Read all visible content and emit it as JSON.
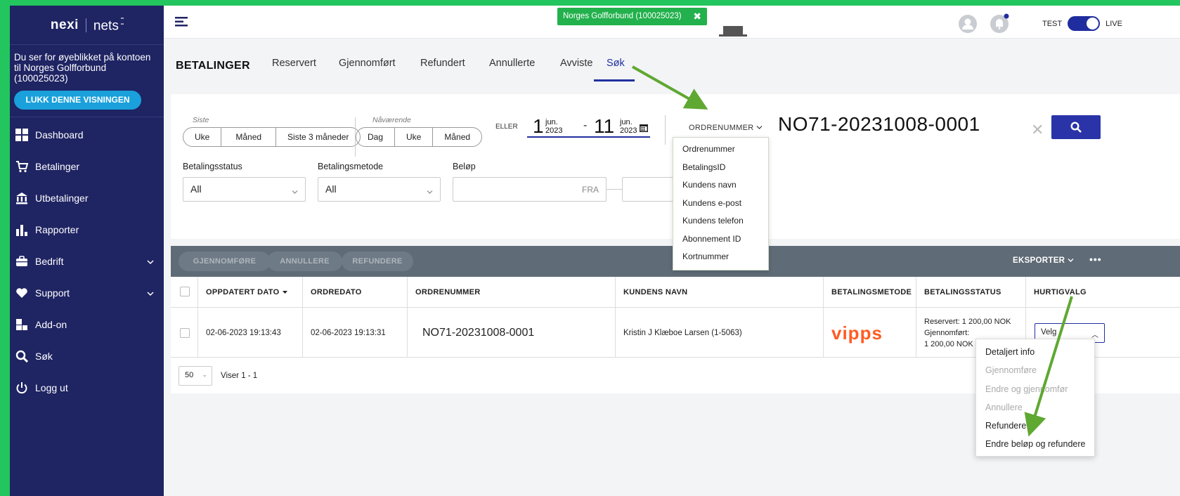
{
  "colors": {
    "sidebar": "#1f2463",
    "accent": "#2130a0",
    "badge": "#22b14c",
    "primary_button": "#2a34a8",
    "vipps": "#ff5b24"
  },
  "sidebar": {
    "logo_primary": "nexi",
    "logo_secondary": "nets",
    "impersonation_text": "Du ser for øyeblikket på kontoen til Norges Golfforbund (100025023)",
    "close_view_button": "LUKK DENNE VISNINGEN",
    "nav": [
      {
        "label": "Dashboard",
        "icon": "dashboard-icon"
      },
      {
        "label": "Betalinger",
        "icon": "cart-icon"
      },
      {
        "label": "Utbetalinger",
        "icon": "bank-icon"
      },
      {
        "label": "Rapporter",
        "icon": "bar-chart-icon"
      },
      {
        "label": "Bedrift",
        "icon": "briefcase-icon"
      },
      {
        "label": "Support",
        "icon": "heart-icon"
      },
      {
        "label": "Add-on",
        "icon": "addon-icon"
      },
      {
        "label": "Søk",
        "icon": "search-icon"
      },
      {
        "label": "Logg ut",
        "icon": "power-icon"
      }
    ]
  },
  "topbar": {
    "org_badge": "Norges Golfforbund (100025023)",
    "env_test": "TEST",
    "env_live": "LIVE"
  },
  "tabs": {
    "title": "BETALINGER",
    "items": [
      "Reservert",
      "Gjennomført",
      "Refundert",
      "Annullerte",
      "Avviste",
      "Søk"
    ],
    "active": "Søk"
  },
  "filters": {
    "last_label": "Siste",
    "last_options": [
      "Uke",
      "Måned",
      "Siste 3 måneder"
    ],
    "current_label": "Nåværende",
    "current_options": [
      "Dag",
      "Uke",
      "Måned"
    ],
    "or_label": "ELLER",
    "date_from_day": "1",
    "date_from_month": "jun.",
    "date_from_year": "2023",
    "date_to_day": "11",
    "date_to_month": "jun.",
    "date_to_year": "2023",
    "search_field_select": "ORDRENUMMER",
    "search_value": "NO71-20231008-0001",
    "status_label": "Betalingsstatus",
    "status_value": "All",
    "method_label": "Betalingsmetode",
    "method_value": "All",
    "amount_label": "Beløp",
    "amount_from_placeholder": "FRA"
  },
  "search_field_menu": [
    "Ordrenummer",
    "BetalingsID",
    "Kundens navn",
    "Kundens e-post",
    "Kundens telefon",
    "Abonnement ID",
    "Kortnummer"
  ],
  "table": {
    "actions": [
      "GJENNOMFØRE",
      "ANNULLERE",
      "REFUNDERE"
    ],
    "export": "EKSPORTER",
    "more": "•••",
    "columns": [
      "OPPDATERT DATO",
      "ORDREDATO",
      "ORDRENUMMER",
      "KUNDENS NAVN",
      "BETALINGSMETODE",
      "BETALINGSSTATUS",
      "HURTIGVALG"
    ],
    "rows": [
      {
        "updated": "02-06-2023 19:13:43",
        "order_date": "02-06-2023 19:13:31",
        "order_number": "NO71-20231008-0001",
        "customer": "Kristin J Klæboe Larsen (1-5063)",
        "method": "vipps",
        "status_line1": "Reservert: 1 200,00 NOK",
        "status_line2": "Gjennomført:",
        "status_line3": "1 200,00 NOK",
        "quick": "Velg"
      }
    ],
    "page_size": "50",
    "showing": "Viser 1 - 1"
  },
  "quick_menu": [
    {
      "label": "Detaljert info",
      "enabled": true
    },
    {
      "label": "Gjennomføre",
      "enabled": false
    },
    {
      "label": "Endre og gjennomfør",
      "enabled": false
    },
    {
      "label": "Annullere",
      "enabled": false
    },
    {
      "label": "Refundere",
      "enabled": true
    },
    {
      "label": "Endre beløp og refundere",
      "enabled": true
    }
  ]
}
